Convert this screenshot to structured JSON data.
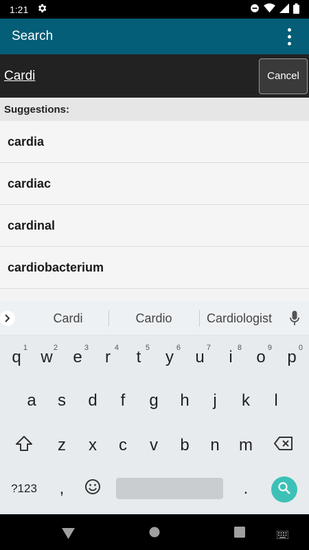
{
  "status_bar": {
    "time": "1:21"
  },
  "app_bar": {
    "title": "Search"
  },
  "search": {
    "query": "Cardi",
    "cancel_label": "Cancel"
  },
  "suggestions": {
    "header": "Suggestions:",
    "items": [
      "cardia",
      "cardiac",
      "cardinal",
      "cardiobacterium"
    ]
  },
  "keyboard": {
    "suggestions": [
      "Cardi",
      "Cardio",
      "Cardiologist"
    ],
    "row1": [
      {
        "k": "q",
        "h": "1"
      },
      {
        "k": "w",
        "h": "2"
      },
      {
        "k": "e",
        "h": "3"
      },
      {
        "k": "r",
        "h": "4"
      },
      {
        "k": "t",
        "h": "5"
      },
      {
        "k": "y",
        "h": "6"
      },
      {
        "k": "u",
        "h": "7"
      },
      {
        "k": "i",
        "h": "8"
      },
      {
        "k": "o",
        "h": "9"
      },
      {
        "k": "p",
        "h": "0"
      }
    ],
    "row2": [
      "a",
      "s",
      "d",
      "f",
      "g",
      "h",
      "j",
      "k",
      "l"
    ],
    "row3": [
      "z",
      "x",
      "c",
      "v",
      "b",
      "n",
      "m"
    ],
    "symbols_label": "?123",
    "comma": ",",
    "period": "."
  },
  "colors": {
    "app_bar": "#045e78",
    "search_bg": "#222222",
    "fab": "#3dc1b7"
  }
}
